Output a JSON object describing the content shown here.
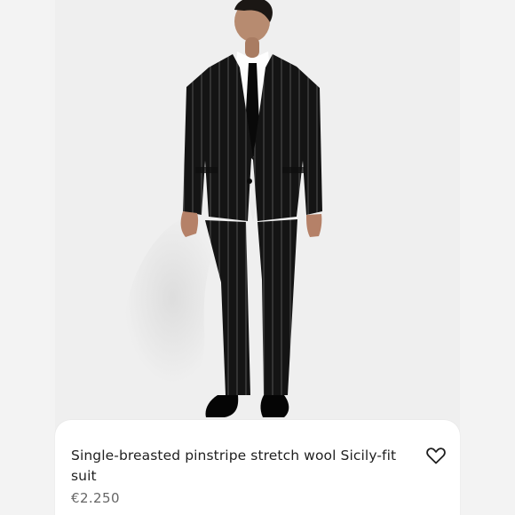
{
  "header": {
    "back_icon": "chevron-left-icon",
    "search_icon": "search-icon",
    "bag_icon": "shopping-bag-icon",
    "menu_icon": "menu-icon"
  },
  "product": {
    "title": "Single-breasted pinstripe stretch wool Sicily-fit suit",
    "price": "€2.250",
    "image_alt": "Model wearing a black pinstripe suit",
    "wishlist_icon": "heart-outline-icon"
  },
  "colors": {
    "background": "#f3f3f3",
    "card": "#ffffff",
    "text": "#1f1f1f",
    "muted": "#666666",
    "suit": "#151515"
  }
}
